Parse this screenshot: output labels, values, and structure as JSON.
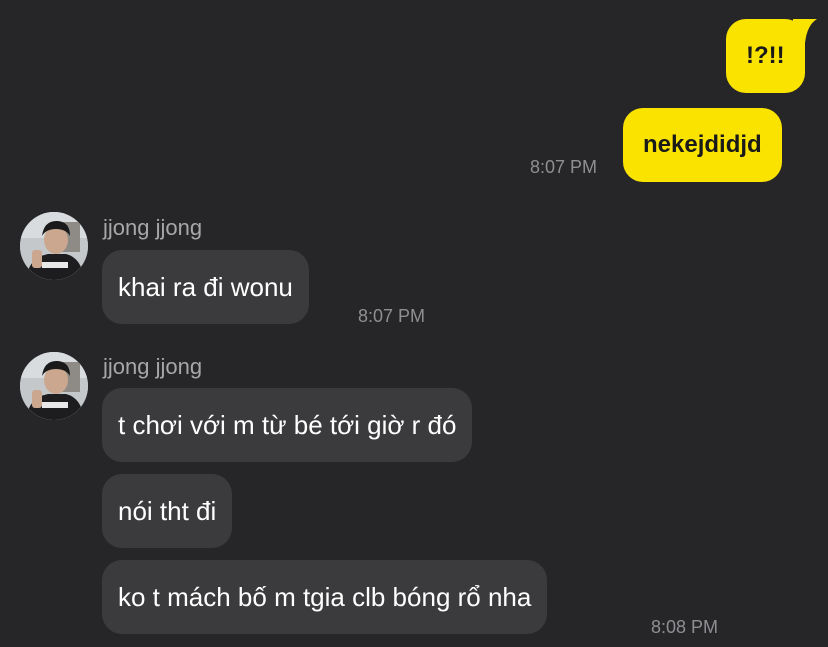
{
  "outgoing": [
    {
      "text": "!?!!"
    },
    {
      "text": "nekejdidjd",
      "time": "8:07 PM"
    }
  ],
  "groups": [
    {
      "sender": "jjong jjong",
      "avatar_icon": "profile-photo",
      "messages": [
        {
          "text": "khai ra đi wonu"
        }
      ],
      "time": "8:07 PM"
    },
    {
      "sender": "jjong jjong",
      "avatar_icon": "profile-photo",
      "messages": [
        {
          "text": "t chơi với m từ bé tới giờ r đó"
        },
        {
          "text": "nói tht đi"
        },
        {
          "text": "ko t mách bố m tgia clb bóng rổ nha"
        }
      ],
      "time": "8:08 PM"
    }
  ],
  "colors": {
    "background": "#262628",
    "outgoing_bubble": "#fbe300",
    "incoming_bubble": "#3b3b3d",
    "timestamp": "#8f8f93",
    "sender_name": "#a7a7aa"
  }
}
